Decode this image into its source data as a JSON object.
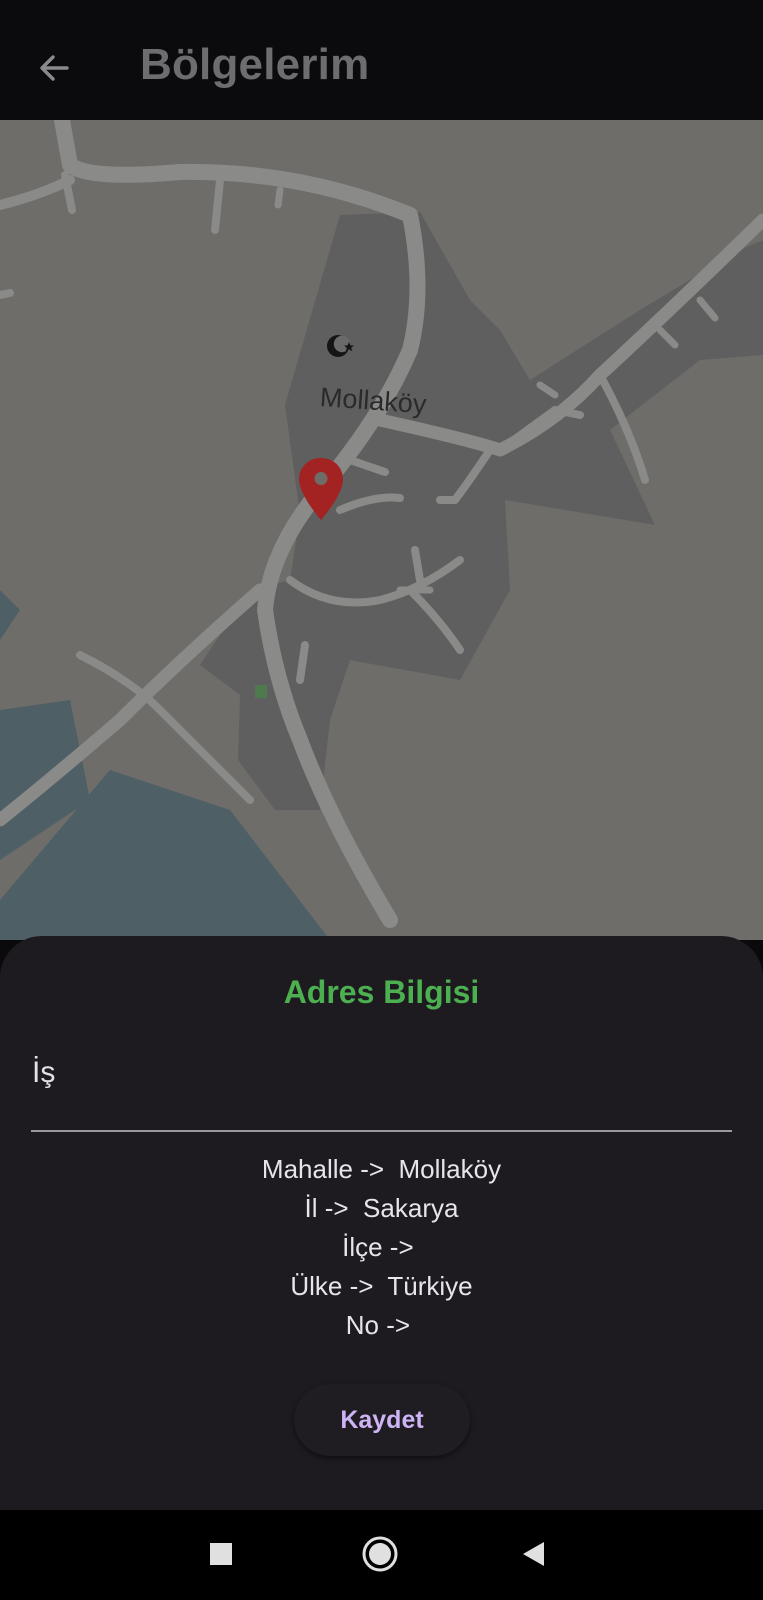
{
  "appbar": {
    "title": "Bölgelerim",
    "back_icon": "arrow-left-icon"
  },
  "map": {
    "place_label": "Mollaköy",
    "marker_icon": "location-pin-icon",
    "mosque_icon": "mosque-icon",
    "marker_color": "#a32222"
  },
  "sheet": {
    "title": "Adres Bilgisi",
    "title_color": "#4caf50",
    "address_name_value": "İş",
    "info": {
      "mahalle": "Mahalle ->  Mollaköy",
      "il": "İl ->  Sakarya",
      "ilce": "İlçe -> ",
      "ulke": "Ülke ->  Türkiye",
      "no": "No -> "
    },
    "save_label": "Kaydet",
    "save_color": "#cdb4f5"
  },
  "navbar": {
    "recents_icon": "square-icon",
    "home_icon": "circle-home-icon",
    "back_icon": "triangle-back-icon"
  }
}
